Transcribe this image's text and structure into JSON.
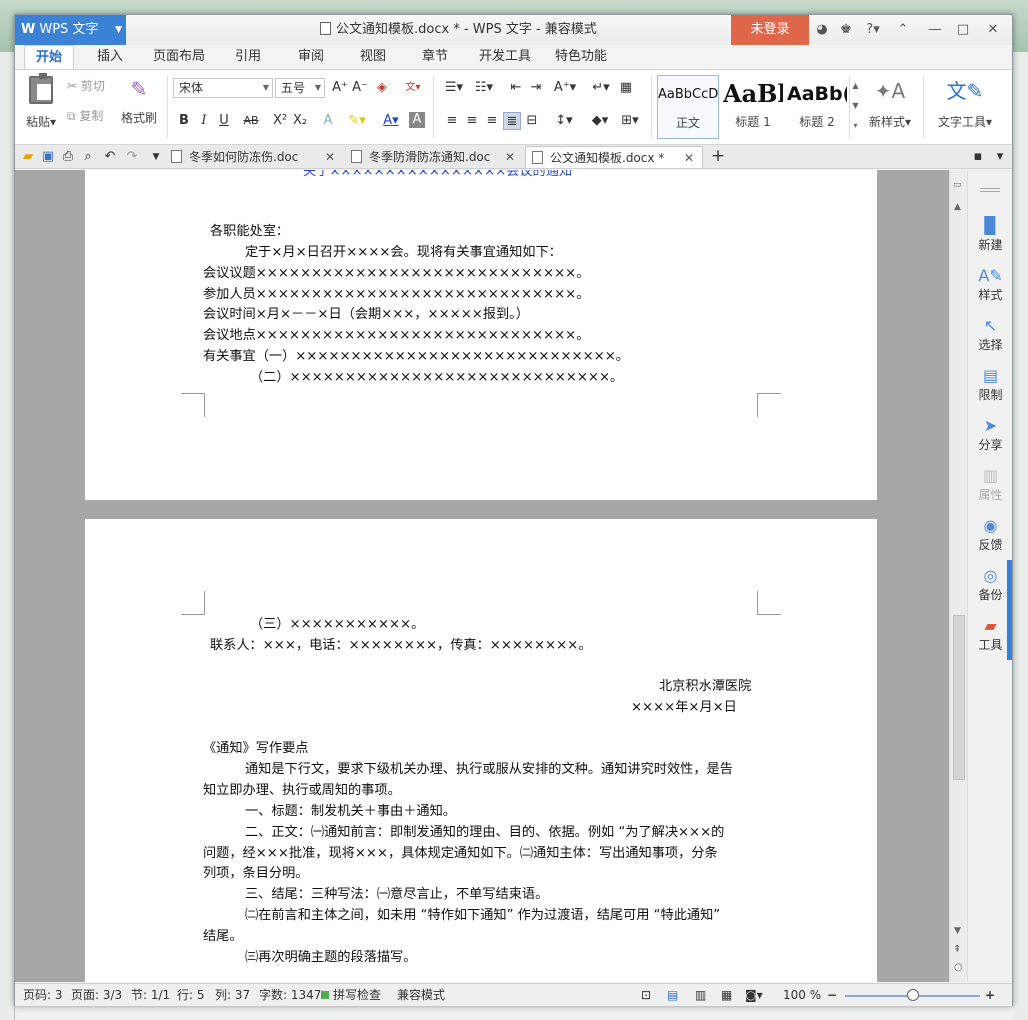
{
  "title_bar": {
    "app_button": "WPS 文字",
    "document_title": "公文通知模板.docx * - WPS 文字 - 兼容模式",
    "login_button": "未登录",
    "help": "?"
  },
  "menu": {
    "tabs": [
      "开始",
      "插入",
      "页面布局",
      "引用",
      "审阅",
      "视图",
      "章节",
      "开发工具",
      "特色功能"
    ],
    "active": "开始"
  },
  "ribbon": {
    "paste": "粘贴",
    "cut": "剪切",
    "copy": "复制",
    "format_painter": "格式刷",
    "font_name": "宋体",
    "font_size": "五号",
    "styles": [
      {
        "preview": "AaBbCcD",
        "name": "正文"
      },
      {
        "preview": "AaBl",
        "name": "标题 1"
      },
      {
        "preview": "AaBb(",
        "name": "标题 2"
      }
    ],
    "new_style": "新样式",
    "text_tools": "文字工具"
  },
  "doc_tabs": [
    {
      "label": "冬季如何防冻伤.doc",
      "active": false
    },
    {
      "label": "冬季防滑防冻通知.doc",
      "active": false
    },
    {
      "label": "公文通知模板.docx *",
      "active": true
    }
  ],
  "document": {
    "page2_top_heading": "关于××××××××××××××××会议的通知",
    "page2_lines": [
      "各职能处室：",
      "定于×月×日召开××××会。现将有关事宜通知如下：",
      "会议议题×××××××××××××××××××××××××××××。",
      "参加人员×××××××××××××××××××××××××××××。",
      "会议时间×月×－－×日（会期×××，×××××报到。）",
      "会议地点×××××××××××××××××××××××××××××。",
      "有关事宜（一）×××××××××××××××××××××××××××××。",
      "（二）×××××××××××××××××××××××××××××。"
    ],
    "page3_lines": [
      "（三）×××××××××××。",
      "联系人：×××，电话：××××××××，传真：××××××××。",
      "北京积水潭医院",
      "××××年×月×日",
      "《通知》写作要点",
      "通知是下行文，要求下级机关办理、执行或服从安排的文种。通知讲究时效性，是告",
      "知立即办理、执行或周知的事项。",
      "一、标题：制发机关＋事由＋通知。",
      "二、正文：㈠通知前言：即制发通知的理由、目的、依据。例如 “为了解决×××的",
      "问题，经×××批准，现将×××，具体规定通知如下。㈡通知主体：写出通知事项，分条",
      "列项，条目分明。",
      "三、结尾：三种写法：㈠意尽言止，不单写结束语。",
      "㈡在前言和主体之间，如未用 “特作如下通知” 作为过渡语，结尾可用 “特此通知”",
      "结尾。",
      "㈢再次明确主题的段落描写。"
    ]
  },
  "side_panel": [
    {
      "label": "新建",
      "icon": "new-doc-icon",
      "enabled": true
    },
    {
      "label": "样式",
      "icon": "style-icon",
      "enabled": true
    },
    {
      "label": "选择",
      "icon": "select-icon",
      "enabled": true
    },
    {
      "label": "限制",
      "icon": "restrict-icon",
      "enabled": true
    },
    {
      "label": "分享",
      "icon": "share-icon",
      "enabled": true
    },
    {
      "label": "属性",
      "icon": "properties-icon",
      "enabled": false
    },
    {
      "label": "反馈",
      "icon": "feedback-icon",
      "enabled": true
    },
    {
      "label": "备份",
      "icon": "backup-icon",
      "enabled": true
    },
    {
      "label": "工具",
      "icon": "toolbox-icon",
      "enabled": true
    }
  ],
  "status_bar": {
    "page_num": "页码: 3",
    "pages": "页面: 3/3",
    "section": "节: 1/1",
    "row": "行: 5",
    "col": "列: 37",
    "word_count": "字数: 1347",
    "spell_check": "拼写检查",
    "compat_mode": "兼容模式",
    "zoom": "100 %",
    "zoom_fraction": 0.5
  },
  "colors": {
    "accent": "#3b82d6",
    "login": "#e0664a",
    "heading_blue": "#2a49c7"
  }
}
